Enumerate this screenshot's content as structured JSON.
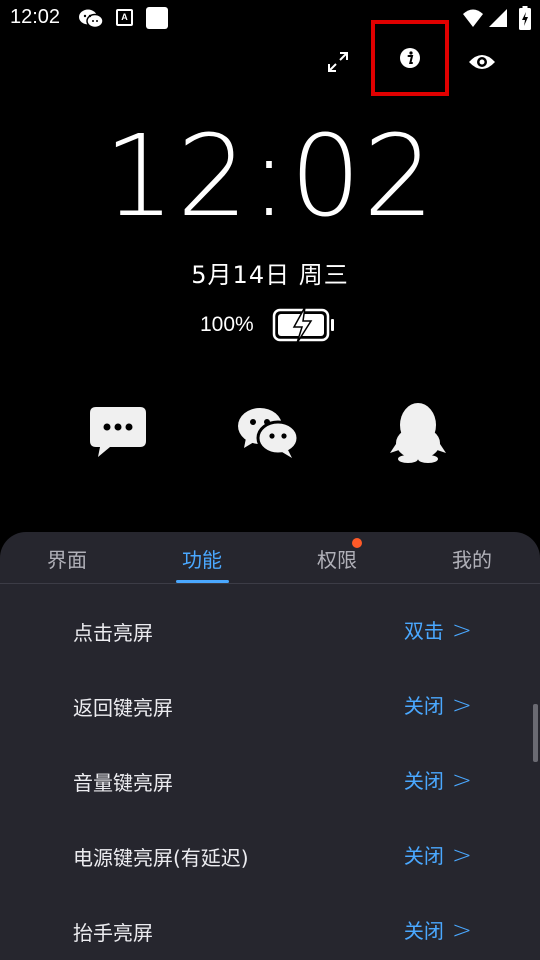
{
  "status_bar": {
    "time": "12:02",
    "icons": [
      "wechat-icon",
      "a-notification-icon",
      "white-square-icon",
      "wifi-icon",
      "signal-icon",
      "battery-charging-icon"
    ]
  },
  "top_actions": [
    "expand-icon",
    "info-icon",
    "eye-icon"
  ],
  "clock": {
    "time": "12:02",
    "date": "5月14日  周三",
    "battery_percent": "100%",
    "battery_level": 1.0
  },
  "apps": [
    "message-icon",
    "wechat-icon",
    "qq-icon"
  ],
  "tabs": [
    {
      "label": "界面",
      "active": false
    },
    {
      "label": "功能",
      "active": true
    },
    {
      "label": "权限",
      "active": false,
      "badge": true
    },
    {
      "label": "我的",
      "active": false
    }
  ],
  "settings": [
    {
      "label": "点击亮屏",
      "value": "双击"
    },
    {
      "label": "返回键亮屏",
      "value": "关闭"
    },
    {
      "label": "音量键亮屏",
      "value": "关闭"
    },
    {
      "label": "电源键亮屏(有延迟)",
      "value": "关闭"
    },
    {
      "label": "抬手亮屏",
      "value": "关闭"
    }
  ],
  "colors": {
    "accent": "#4aa8ff",
    "panel": "#26262e",
    "badge": "#ff5a28",
    "highlight_box": "#e00000"
  }
}
